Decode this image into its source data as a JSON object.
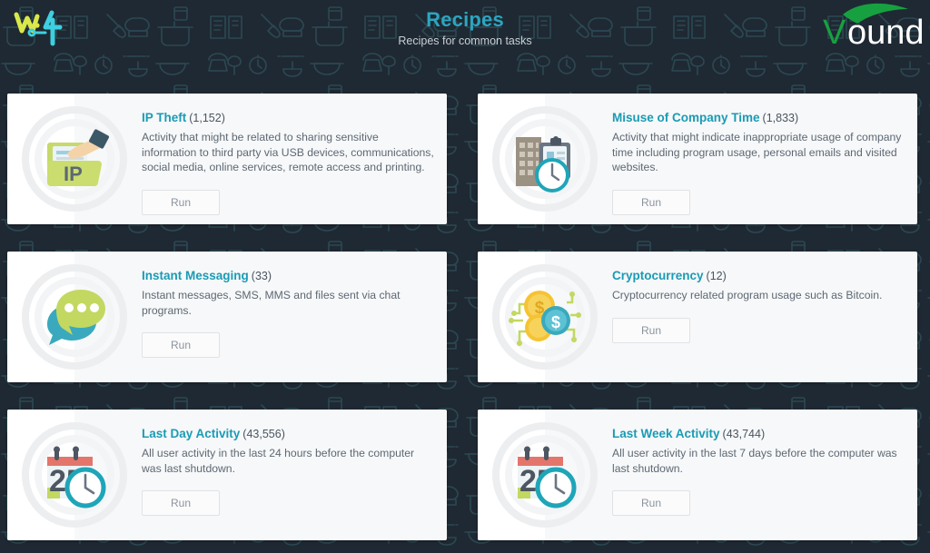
{
  "header": {
    "title": "Recipes",
    "subtitle": "Recipes for common tasks",
    "app_logo_name": "w4-app-logo",
    "brand_logo_text_v": "V",
    "brand_logo_text_rest": "ound",
    "title_color": "#2ca5c0",
    "subtitle_color": "#c9cfd4",
    "background_color": "#1f2933",
    "pattern_color": "#2d4a53"
  },
  "cards": [
    {
      "title": "IP Theft",
      "count": "(1,152)",
      "description": "Activity that might be related to sharing sensitive information to third party via USB devices, communications, social media, online services, remote access and printing.",
      "run_label": "Run",
      "icon_name": "ip-theft-icon"
    },
    {
      "title": "Misuse of Company Time",
      "count": "(1,833)",
      "description": "Activity that might indicate inappropriate usage of company time including program usage, personal emails and visited websites.",
      "run_label": "Run",
      "icon_name": "company-time-icon"
    },
    {
      "title": "Instant Messaging",
      "count": "(33)",
      "description": "Instant messages, SMS, MMS and files sent via chat programs.",
      "run_label": "Run",
      "icon_name": "instant-messaging-icon"
    },
    {
      "title": "Cryptocurrency",
      "count": "(12)",
      "description": "Cryptocurrency related program usage such as Bitcoin.",
      "run_label": "Run",
      "icon_name": "cryptocurrency-icon"
    },
    {
      "title": "Last Day Activity",
      "count": "(43,556)",
      "description": "All user activity in the last 24 hours before the computer was last shutdown.",
      "run_label": "Run",
      "icon_name": "last-day-activity-icon"
    },
    {
      "title": "Last Week Activity",
      "count": "(43,744)",
      "description": "All user activity in the last 7 days before the computer was last shutdown.",
      "run_label": "Run",
      "icon_name": "last-week-activity-icon"
    }
  ],
  "icon_calendar_day": "25"
}
